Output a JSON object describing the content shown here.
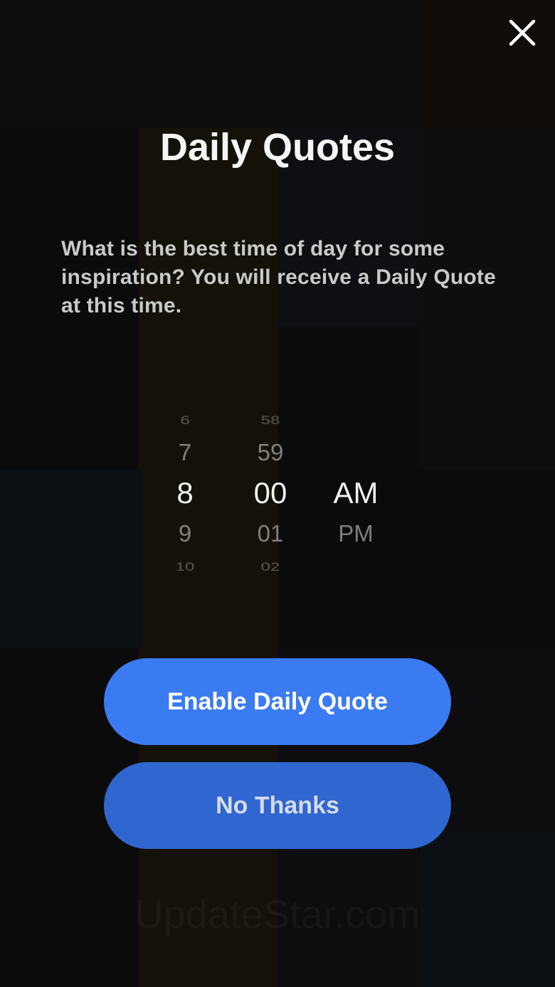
{
  "modal": {
    "title": "Daily Quotes",
    "description": "What is the best time of day for some inspiration?  You will receive a Daily Quote at this time."
  },
  "time_picker": {
    "hour": {
      "far_above": "6",
      "above": "7",
      "selected": "8",
      "below": "9",
      "far_below": "10"
    },
    "minute": {
      "far_above": "58",
      "above": "59",
      "selected": "00",
      "below": "01",
      "far_below": "02"
    },
    "period": {
      "selected": "AM",
      "below": "PM"
    }
  },
  "buttons": {
    "enable_label": "Enable Daily Quote",
    "no_thanks_label": "No Thanks"
  },
  "watermark": "UpdateStar.com",
  "icons": {
    "close": "close-icon"
  },
  "colors": {
    "primary_button": "#3b7bf1",
    "secondary_button": "#2f66cf",
    "background": "#0c0b0c"
  }
}
